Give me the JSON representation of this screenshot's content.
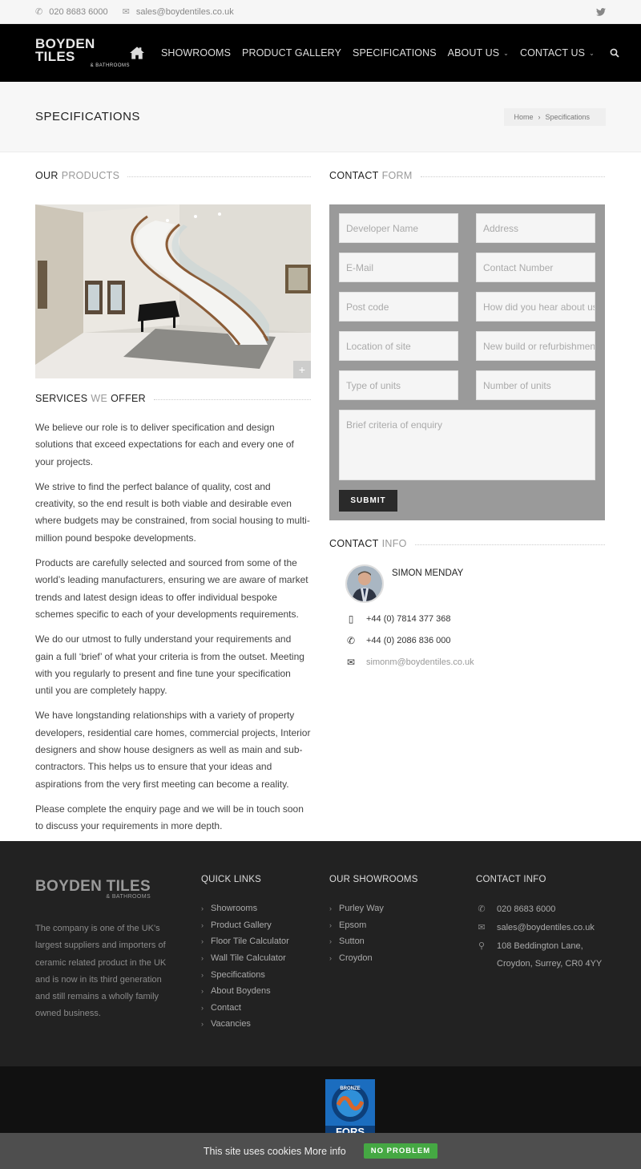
{
  "topbar": {
    "phone": "020 8683 6000",
    "email": "sales@boydentiles.co.uk"
  },
  "header": {
    "logo_main": "BOYDEN TILES",
    "logo_sub": "& BATHROOMS",
    "nav": [
      {
        "label": "SHOWROOMS",
        "dropdown": false
      },
      {
        "label": "PRODUCT GALLERY",
        "dropdown": false
      },
      {
        "label": "SPECIFICATIONS",
        "dropdown": false
      },
      {
        "label": "ABOUT US",
        "dropdown": true
      },
      {
        "label": "CONTACT US",
        "dropdown": true
      }
    ]
  },
  "page": {
    "title": "SPECIFICATIONS",
    "breadcrumb": [
      "Home",
      "Specifications"
    ]
  },
  "products": {
    "title_dark": "OUR",
    "title_light": "PRODUCTS"
  },
  "services": {
    "title_dark1": "SERVICES",
    "title_light": "WE",
    "title_dark2": "OFFER",
    "paragraphs": [
      "We believe our role is to deliver specification and design solutions that exceed expectations for each and every one of your projects.",
      "We strive to find the perfect balance of quality, cost and creativity, so the end result is both viable and desirable even where budgets may be constrained, from social housing to multi-million pound bespoke developments.",
      "Products are carefully selected and sourced from some of the world’s leading manufacturers, ensuring we are aware of market trends and latest design ideas to offer individual bespoke schemes specific to each of your developments requirements.",
      "We do our utmost to fully understand your requirements and gain a full ‘brief’ of what your criteria is from the outset. Meeting with you regularly to present and fine tune your specification until you are completely happy.",
      "We have longstanding relationships with a variety of property developers, residential care homes, commercial projects, Interior designers and show house designers as well as main and sub-contractors. This helps us to ensure that your ideas and aspirations from the very first meeting can become a reality.",
      "Please complete the enquiry page and we will be in touch soon to discuss your requirements in more depth."
    ]
  },
  "contact_form": {
    "title_dark": "CONTACT",
    "title_light": "FORM",
    "fields": [
      "Developer Name",
      "Address",
      "E-Mail",
      "Contact Number",
      "Post code",
      "How did you hear about us?",
      "Location of site",
      "New build or refurbishment",
      "Type of units",
      "Number of units"
    ],
    "textarea": "Brief criteria of enquiry",
    "submit": "SUBMIT"
  },
  "contact_info": {
    "title_dark": "CONTACT",
    "title_light": "INFO",
    "name": "SIMON MENDAY",
    "mobile": "+44 (0) 7814 377 368",
    "phone": "+44 (0) 2086 836 000",
    "email": "simonm@boydentiles.co.uk"
  },
  "footer": {
    "logo_main": "BOYDEN TILES",
    "logo_sub": "& BATHROOMS",
    "about": "The company is one of the UK's largest suppliers and importers of ceramic related product in the UK and is now in its third generation and still remains a wholly family owned business.",
    "quick_links_title": "QUICK LINKS",
    "quick_links": [
      "Showrooms",
      "Product Gallery",
      "Floor Tile Calculator",
      "Wall Tile Calculator",
      "Specifications",
      "About Boydens",
      "Contact",
      "Vacancies"
    ],
    "showrooms_title": "OUR SHOWROOMS",
    "showrooms": [
      "Purley Way",
      "Epsom",
      "Sutton",
      "Croydon"
    ],
    "contact_title": "CONTACT INFO",
    "phone": "020 8683 6000",
    "email": "sales@boydentiles.co.uk",
    "address_line1": "108 Beddington Lane,",
    "address_line2": "Croydon, Surrey, CR0 4YY"
  },
  "badge": {
    "top_text": "BRONZE",
    "main_text": "FORS"
  },
  "cookie": {
    "text": "This site uses cookies More info",
    "button": "NO PROBLEM"
  }
}
